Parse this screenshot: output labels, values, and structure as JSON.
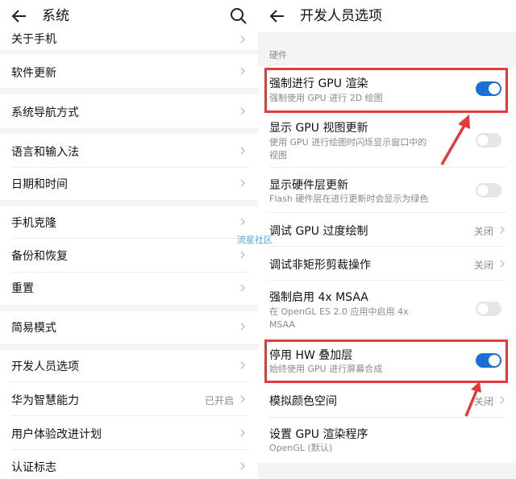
{
  "left": {
    "title": "系统",
    "items": [
      {
        "label": "关于手机"
      },
      {
        "label": "软件更新"
      },
      {
        "label": "系统导航方式"
      },
      {
        "label": "语言和输入法"
      },
      {
        "label": "日期和时间"
      },
      {
        "label": "手机克隆"
      },
      {
        "label": "备份和恢复"
      },
      {
        "label": "重置"
      },
      {
        "label": "简易模式"
      },
      {
        "label": "开发人员选项"
      },
      {
        "label": "华为智慧能力",
        "value": "已开启"
      },
      {
        "label": "用户体验改进计划"
      },
      {
        "label": "认证标志"
      }
    ]
  },
  "right": {
    "title": "开发人员选项",
    "section": "硬件",
    "items": [
      {
        "label": "强制进行 GPU 渲染",
        "sub": "强制使用 GPU 进行 2D 绘图",
        "toggle": "on"
      },
      {
        "label": "显示 GPU 视图更新",
        "sub": "使用 GPU 进行绘图时闪烁显示窗口中的",
        "sub2": "视图",
        "toggle": "off"
      },
      {
        "label": "显示硬件层更新",
        "sub": "Flash 硬件层在进行更新时会显示为绿色",
        "toggle": "off"
      },
      {
        "label": "调试 GPU 过度绘制",
        "value": "关闭"
      },
      {
        "label": "调试非矩形剪裁操作",
        "value": "关闭"
      },
      {
        "label": "强制启用 4x MSAA",
        "sub": "在 OpenGL ES 2.0 应用中启用 4x",
        "sub2": "MSAA",
        "toggle": "off"
      },
      {
        "label": "停用 HW 叠加层",
        "sub": "始终使用 GPU 进行屏幕合成",
        "toggle": "on"
      },
      {
        "label": "模拟颜色空间",
        "value": "关闭"
      },
      {
        "label": "设置 GPU 渲染程序",
        "sub": "OpenGL (默认)"
      }
    ]
  },
  "watermark": "流星社区",
  "colors": {
    "accent": "#1a6fd4",
    "highlight": "#e23b3b",
    "watermark": "#4aa8e8"
  }
}
